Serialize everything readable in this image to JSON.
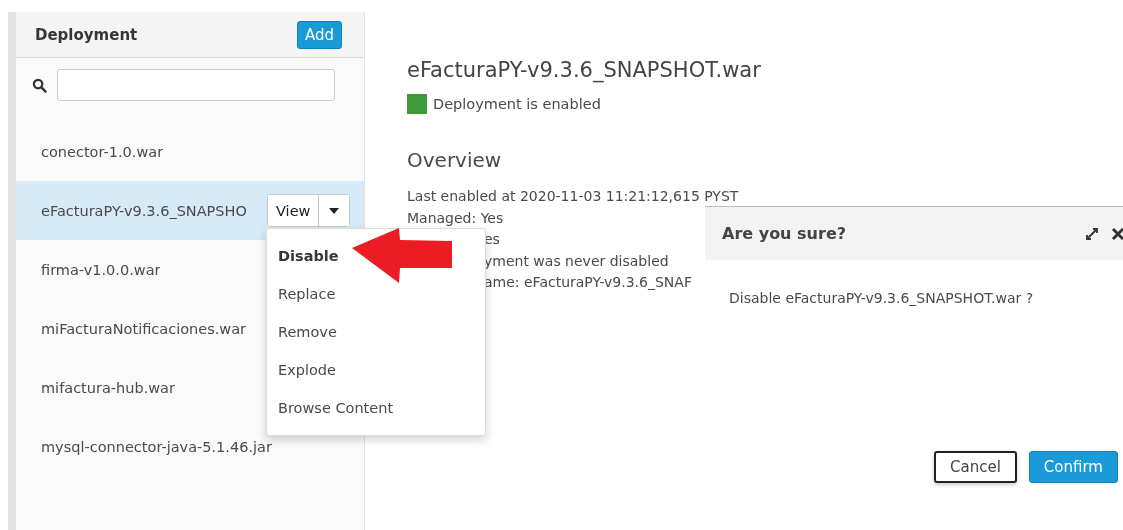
{
  "sidebar": {
    "title": "Deployment",
    "add_button": "Add",
    "items": [
      {
        "name": "conector-1.0.war",
        "selected": false
      },
      {
        "name": "eFacturaPY-v9.3.6_SNAPSHO",
        "selected": true,
        "view_button": "View"
      },
      {
        "name": "firma-v1.0.0.war",
        "selected": false
      },
      {
        "name": "miFacturaNotificaciones.war",
        "selected": false
      },
      {
        "name": "mifactura-hub.war",
        "selected": false
      },
      {
        "name": "mysql-connector-java-5.1.46.jar",
        "selected": false
      }
    ]
  },
  "menu": {
    "items": [
      {
        "label": "Disable",
        "selected": true
      },
      {
        "label": "Replace",
        "selected": false
      },
      {
        "label": "Remove",
        "selected": false
      },
      {
        "label": "Explode",
        "selected": false
      },
      {
        "label": "Browse Content",
        "selected": false
      }
    ]
  },
  "main": {
    "title": "eFacturaPY-v9.3.6_SNAPSHOT.war",
    "status": {
      "text": "Deployment is enabled",
      "enabled": true
    },
    "overview_heading": "Overview",
    "details": [
      {
        "text": "Last enabled at 2020-11-03 11:21:12,615 PYST",
        "covered": false
      },
      {
        "text": "Managed: Yes",
        "covered": false
      },
      {
        "text": "es",
        "covered": true
      },
      {
        "text": "yment was never disabled",
        "covered": true
      },
      {
        "text": "ame: eFacturaPY-v9.3.6_SNAF",
        "covered": true
      }
    ]
  },
  "dialog": {
    "title": "Are you sure?",
    "message": "Disable eFacturaPY-v9.3.6_SNAPSHOT.war ?",
    "buttons": [
      {
        "label": "Cancel",
        "kind": "default"
      },
      {
        "label": "Confirm",
        "kind": "primary"
      }
    ]
  }
}
